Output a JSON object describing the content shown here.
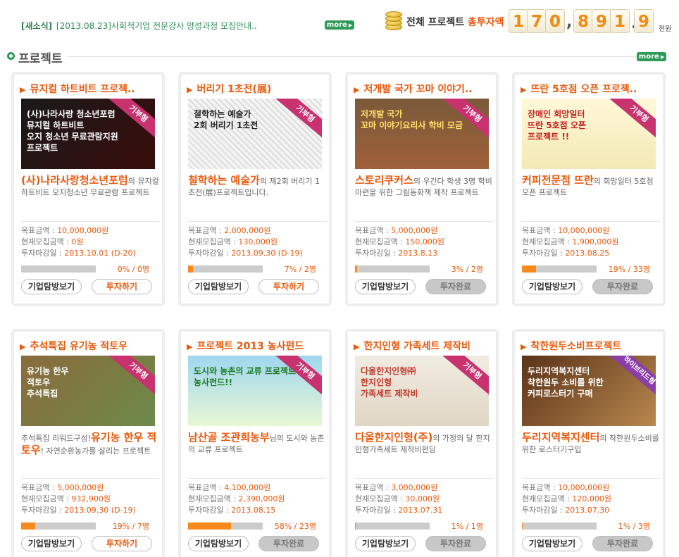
{
  "news": {
    "tag": "[새소식]",
    "text": "[2013.08.23]사회적기업 전문강사 양성과정 모집안내..",
    "more_label": "more"
  },
  "total": {
    "label_prefix": "전체 프로젝트 ",
    "label_highlight": "총투자액",
    "digits": [
      "1",
      "7",
      "0",
      "8",
      "9",
      "1",
      "9"
    ],
    "unit": "천원"
  },
  "section": {
    "title": "프로젝트",
    "more_label": "more"
  },
  "labels": {
    "goal": "목표금액 : ",
    "current": "현재모집금액 : ",
    "deadline": "투자마감일 : ",
    "explore": "기업탐방보기",
    "invest": "투자하기",
    "done": "투자완료"
  },
  "colors": {
    "accent": "#e8590c",
    "green": "#2e9a58",
    "progress": "#f68a1c",
    "ribbon": "#c8336f"
  },
  "projects": [
    {
      "title": "뮤지컬 하트비트 프로젝..",
      "thumb_text": "(사)나라사랑 청소년포럼\n뮤지컬 하트비트\n오지 청소년 무료관람지원\n프로젝트",
      "ribbon": "기부형",
      "org": "(사)나라사랑청소년포럼",
      "desc": "의 뮤지컬 하트비트 오지청소년 무료관람 프로젝트",
      "goal": "10,000,000원",
      "current": "0원",
      "deadline": "2013.10.01 (D-20)",
      "progress": 0,
      "pct": "0% / 0명",
      "status": "invest"
    },
    {
      "title": "버리기 1초전(展)",
      "thumb_text": "철학하는 예술가\n2회 버리기 1초전",
      "ribbon": "기부형",
      "org": "철학하는 예술가",
      "desc": "의 제2회 버리기 1초전(展)프로젝트입니다.",
      "goal": "2,000,000원",
      "current": "130,000원",
      "deadline": "2013.09.30 (D-19)",
      "progress": 7,
      "pct": "7% / 2명",
      "status": "invest"
    },
    {
      "title": "저개발 국가 꼬마 이야기..",
      "thumb_text": "저개발 국가\n꼬마 이야기요리사 학비 모금",
      "ribbon": "기부형",
      "org": "스토리쿠커스",
      "desc": "의 우간다 학생 3명 학비 마련을 위한 그림동화책 제작 프로젝트",
      "goal": "5,000,000원",
      "current": "150,000원",
      "deadline": "2013.8.13",
      "progress": 3,
      "pct": "3% / 2명",
      "status": "done"
    },
    {
      "title": "뜨란 5호점 오픈 프로젝..",
      "thumb_text": "장애인 희망일터\n뜨란 5호점 오픈\n프로젝트 !!",
      "ribbon": "기부형",
      "org": "커피전문점 뜨란",
      "desc": "의 희망일터 5호점 오픈 프로젝트",
      "goal": "10,000,000원",
      "current": "1,900,000원",
      "deadline": "2013.08.25",
      "progress": 19,
      "pct": "19% / 33명",
      "status": "done"
    },
    {
      "title": "추석특집 유기농 적토우",
      "thumb_text": "유기농 한우\n적토우\n추석특집",
      "ribbon": "기부형",
      "org": "유기농 한우 적토우",
      "desc_prefix": "추석특집 리워드구성!",
      "desc": "! 자연순환농가를 살리는 프로젝트",
      "goal": "5,000,000원",
      "current": "932,900원",
      "deadline": "2013.09.30 (D-19)",
      "progress": 19,
      "pct": "19% / 7명",
      "status": "invest"
    },
    {
      "title": "프로젝트 2013 농사펀드",
      "thumb_text": "도시와 농촌의 교류 프로젝트\n농사펀드!!",
      "ribbon": "기부형",
      "org": "남산골 조관희농부",
      "desc": "님의 도시와 농촌의 교류 프로젝트",
      "goal": "4,100,000원",
      "current": "2,390,000원",
      "deadline": "2013.08.15",
      "progress": 58,
      "pct": "58% / 23명",
      "status": "done"
    },
    {
      "title": "한지인형 가족세트 제작비",
      "thumb_text": "다올한지인형㈜\n한지인형\n가족세트 제작비",
      "ribbon": "기부형",
      "org": "다올한지인형(주)",
      "desc": "의 가정의 달 한지인형가족세트 제작비펀딩",
      "goal": "3,000,000원",
      "current": "30,000원",
      "deadline": "2013.07.31",
      "progress": 1,
      "pct": "1% / 1명",
      "status": "done"
    },
    {
      "title": "착한원두소비프로젝트",
      "thumb_text": "두리지역복지센터\n착한원두 소비를 위한\n커피로스터기 구매",
      "ribbon": "하이브리드형",
      "org": "두리지역복지센터",
      "desc": "의 착한원두소비를 위한 로스터기구입",
      "goal": "10,000,000원",
      "current": "120,000원",
      "deadline": "2013.07.30",
      "progress": 1,
      "pct": "1% / 3명",
      "status": "done"
    }
  ]
}
